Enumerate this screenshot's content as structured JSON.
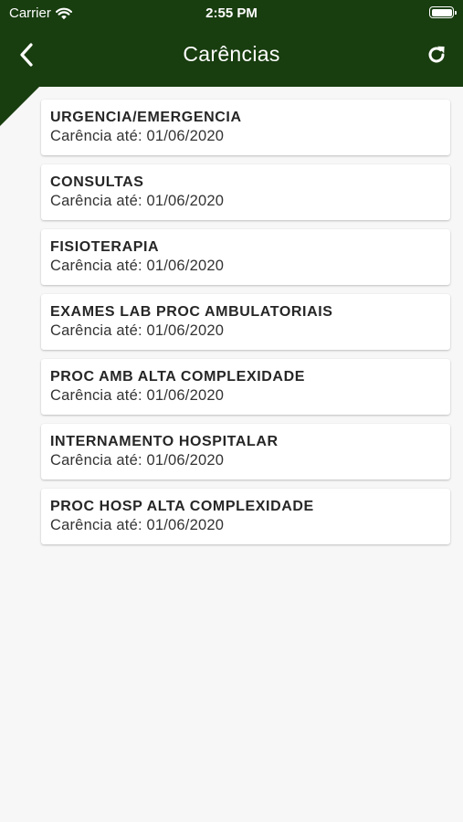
{
  "status_bar": {
    "carrier": "Carrier",
    "time": "2:55 PM"
  },
  "header": {
    "title": "Carências",
    "back_icon": "chevron-left-icon",
    "refresh_icon": "refresh-icon",
    "background_color": "#183d0f"
  },
  "items": [
    {
      "title": "URGENCIA/EMERGENCIA",
      "subtitle": "Carência até: 01/06/2020"
    },
    {
      "title": "CONSULTAS",
      "subtitle": "Carência até: 01/06/2020"
    },
    {
      "title": "FISIOTERAPIA",
      "subtitle": "Carência até: 01/06/2020"
    },
    {
      "title": "EXAMES LAB PROC AMBULATORIAIS",
      "subtitle": "Carência até: 01/06/2020"
    },
    {
      "title": "PROC AMB ALTA COMPLEXIDADE",
      "subtitle": "Carência até: 01/06/2020"
    },
    {
      "title": "INTERNAMENTO HOSPITALAR",
      "subtitle": "Carência até: 01/06/2020"
    },
    {
      "title": "PROC HOSP ALTA COMPLEXIDADE",
      "subtitle": "Carência até: 01/06/2020"
    }
  ]
}
